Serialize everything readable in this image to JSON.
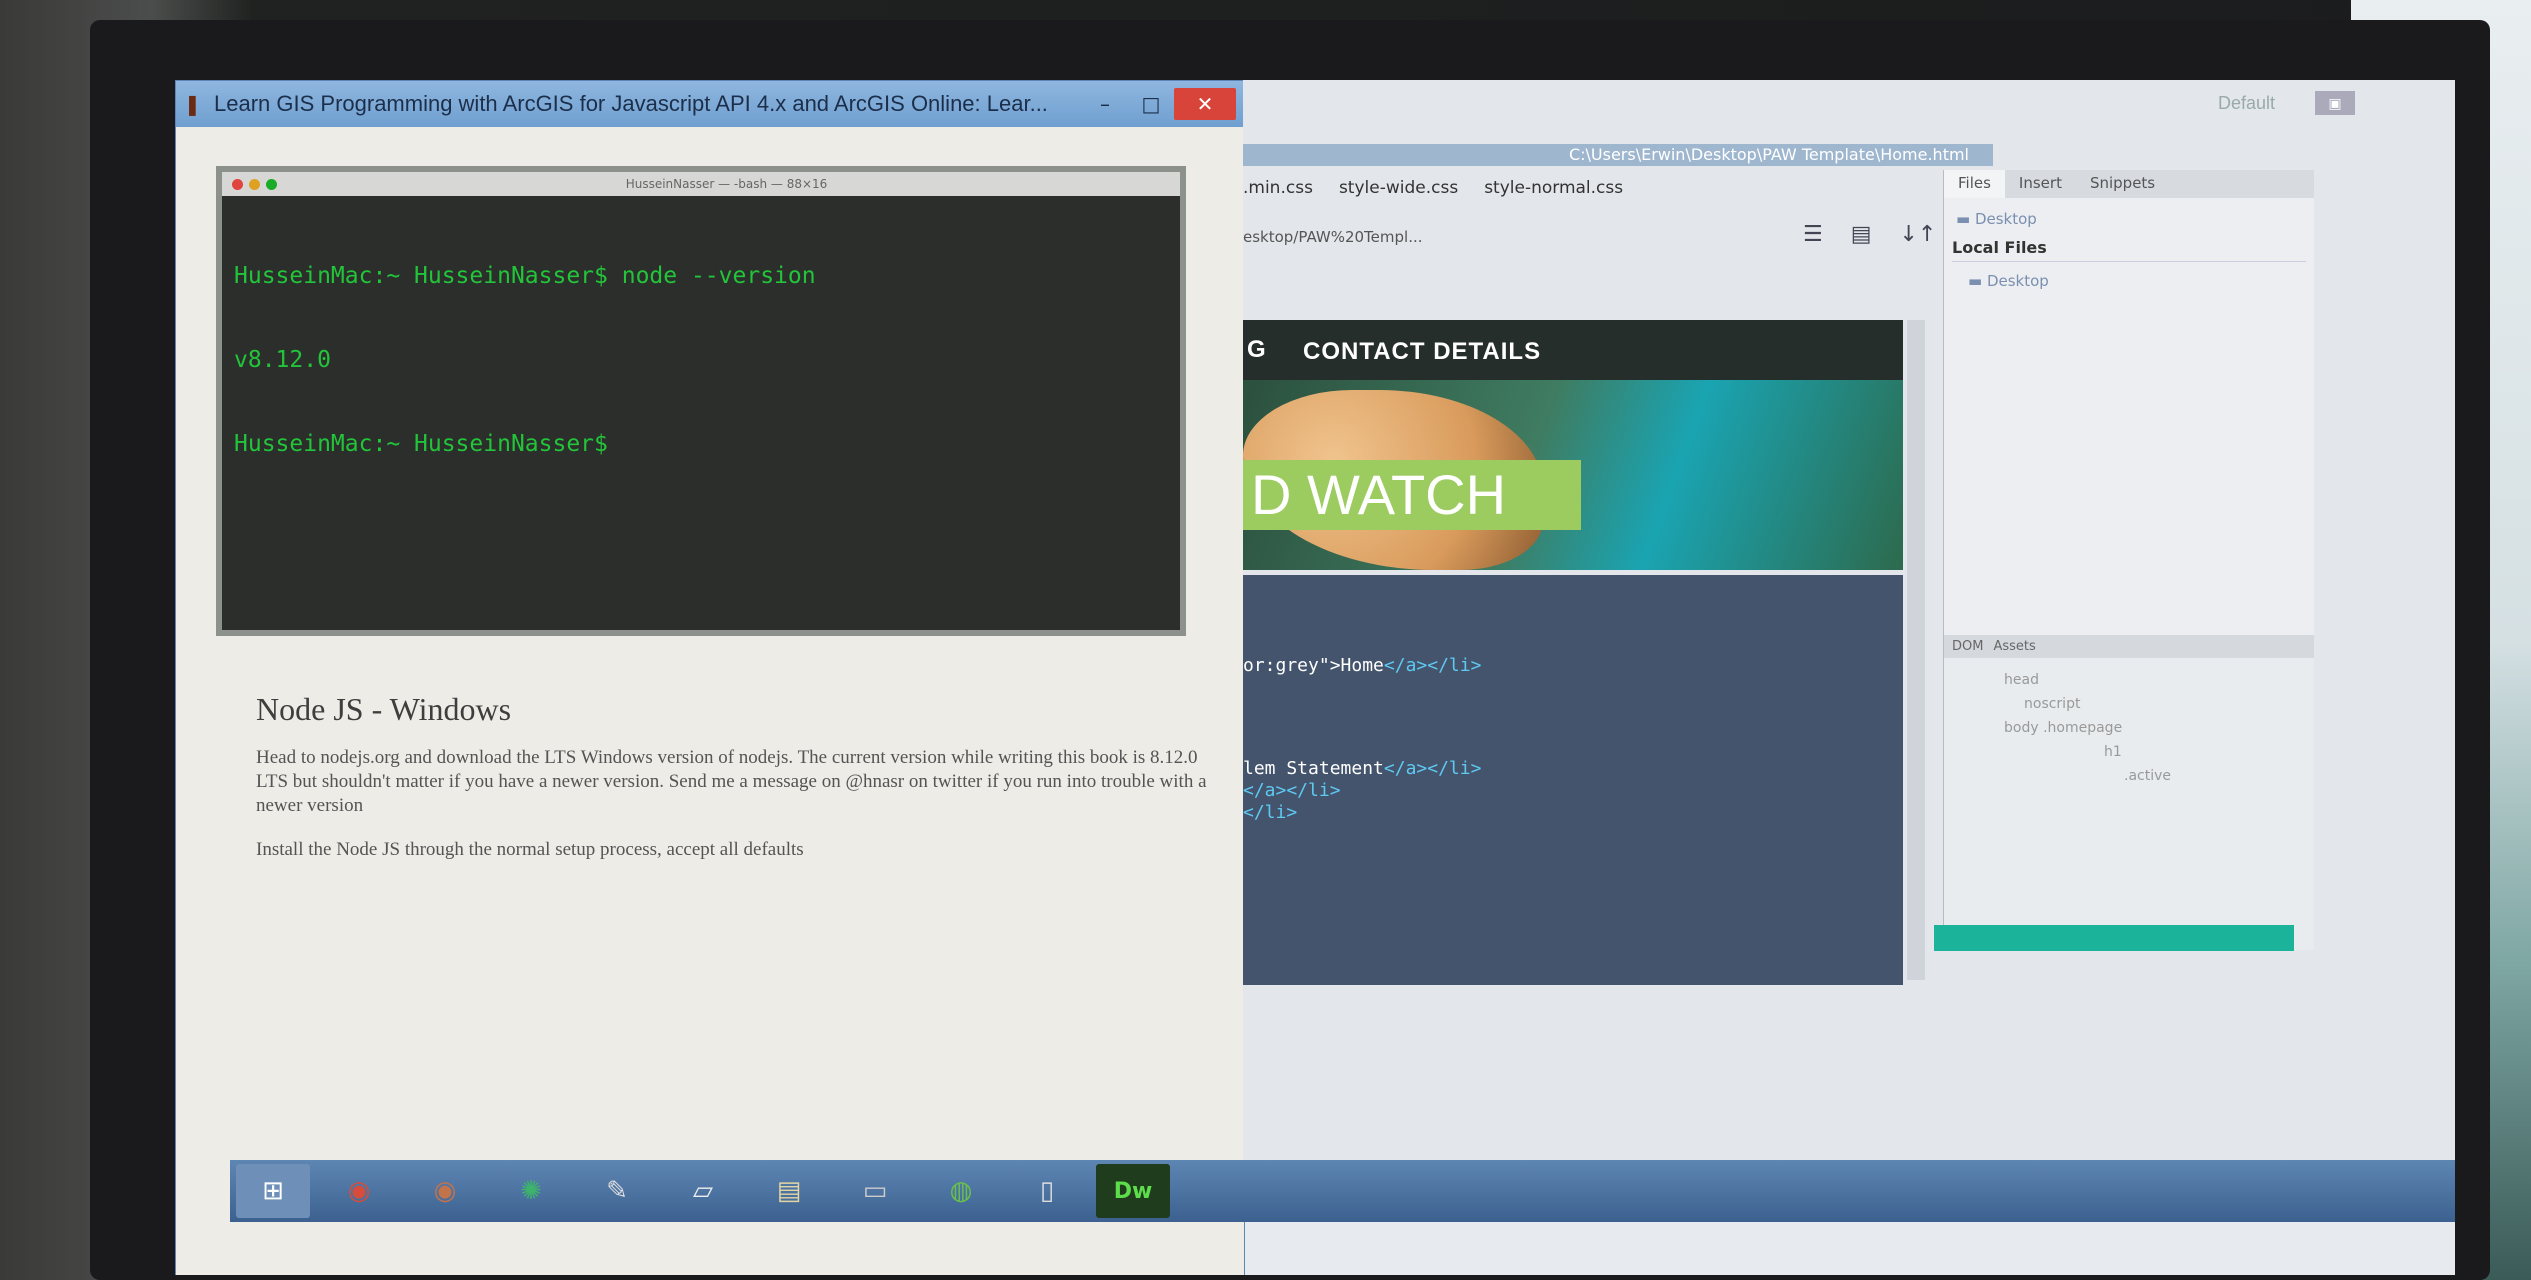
{
  "left_window": {
    "title": "Learn GIS Programming with ArcGIS for Javascript API 4.x and ArcGIS Online: Lear...",
    "controls": {
      "minimize": "–",
      "maximize": "□",
      "close": "✕"
    },
    "terminal": {
      "title": "HusseinNasser — -bash — 88×16",
      "lines": [
        "HusseinMac:~ HusseinNasser$ node --version",
        "v8.12.0",
        "HusseinMac:~ HusseinNasser$"
      ]
    },
    "doc": {
      "heading": "Node JS - Windows",
      "paragraph1": "Head to nodejs.org and download the LTS Windows version of nodejs. The current version while writing this book is 8.12.0 LTS but shouldn't matter if you have a newer version. Send me a message on @hnasr on twitter if you run into trouble with a newer version",
      "paragraph2": "Install the Node JS through the normal setup process, accept all defaults"
    }
  },
  "right_window": {
    "layout_label": "Default",
    "path": "C:\\Users\\Erwin\\Desktop\\PAW Template\\Home.html",
    "tabs": [
      ".min.css",
      "style-wide.css",
      "style-normal.css"
    ],
    "address": "esktop/PAW%20Templ...",
    "live_view": {
      "nav_prefix": "G",
      "nav_contact": "CONTACT DETAILS",
      "hero_text": "D WATCH"
    },
    "code": {
      "line1_attr": "or:grey\">",
      "line1_text": "Home",
      "line1_close": "</a></li>",
      "line2_text": "lem Statement",
      "line2_close": "</a></li>",
      "line3": "</a></li>",
      "line4": "</li>"
    },
    "files_panel": {
      "tabs": [
        "Files",
        "Insert",
        "Snippets"
      ],
      "site_select": "Desktop",
      "local_files_label": "Local Files",
      "root_item": "Desktop"
    },
    "dom_panel": {
      "tabs": [
        "DOM",
        "Assets"
      ],
      "rows": [
        "head",
        "noscript",
        "body .homepage",
        "",
        "",
        "",
        "",
        "h1",
        "",
        "",
        ".active",
        ""
      ]
    }
  },
  "taskbar": {
    "items": [
      "start",
      "chrome",
      "chrome-2",
      "network",
      "pen",
      "folder-1",
      "folder-2",
      "explorer",
      "globe",
      "notepad",
      "Dw"
    ]
  },
  "colors": {
    "terminal_green": "#22c53a",
    "code_tag": "#5ec9f2",
    "hero_green": "#9ccc5f",
    "title_blue": "#6f9fd0"
  }
}
